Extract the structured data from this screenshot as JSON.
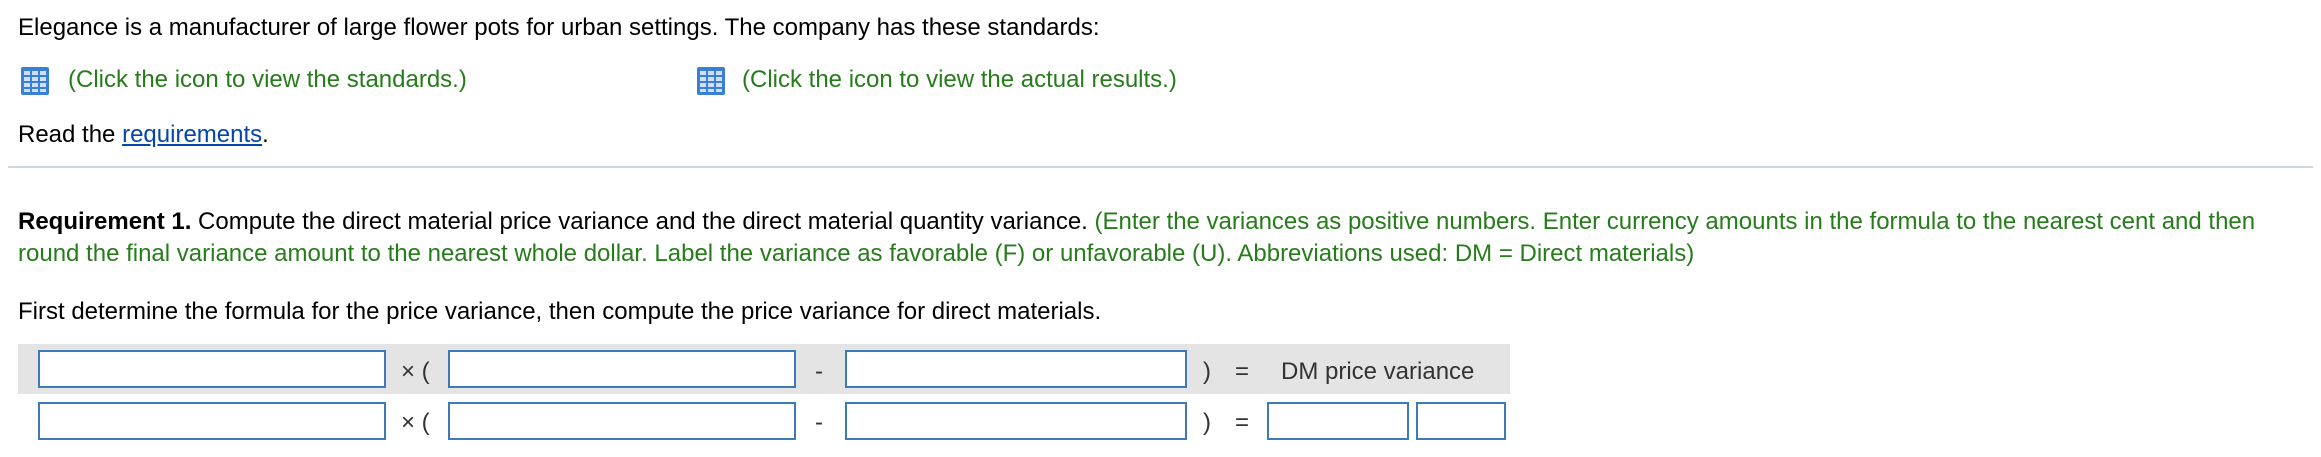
{
  "intro": "Elegance is a manufacturer of large flower pots for urban settings. The company has these standards:",
  "standards_link": "(Click the icon to view the standards.)",
  "actual_link": "(Click the icon to view the actual results.)",
  "read_prefix": "Read the ",
  "requirements_link": "requirements",
  "read_suffix": ".",
  "requirement": {
    "label": "Requirement 1.",
    "text": " Compute the direct material price variance and the direct material quantity variance. ",
    "instructions": "(Enter the variances as positive numbers. Enter currency amounts in the formula to the nearest cent and then round the final variance amount to the nearest whole dollar. Label the variance as favorable (F) or unfavorable (U). Abbreviations used: DM = Direct materials)"
  },
  "first_determine": "First determine the formula for the price variance, then compute the price variance for direct materials.",
  "formula": {
    "times_open": "× (",
    "minus": "-",
    "close": ")",
    "equals": "=",
    "result_label": "DM price variance"
  },
  "icon_color": "#3b7fd4",
  "accent_green": "#267c1a"
}
